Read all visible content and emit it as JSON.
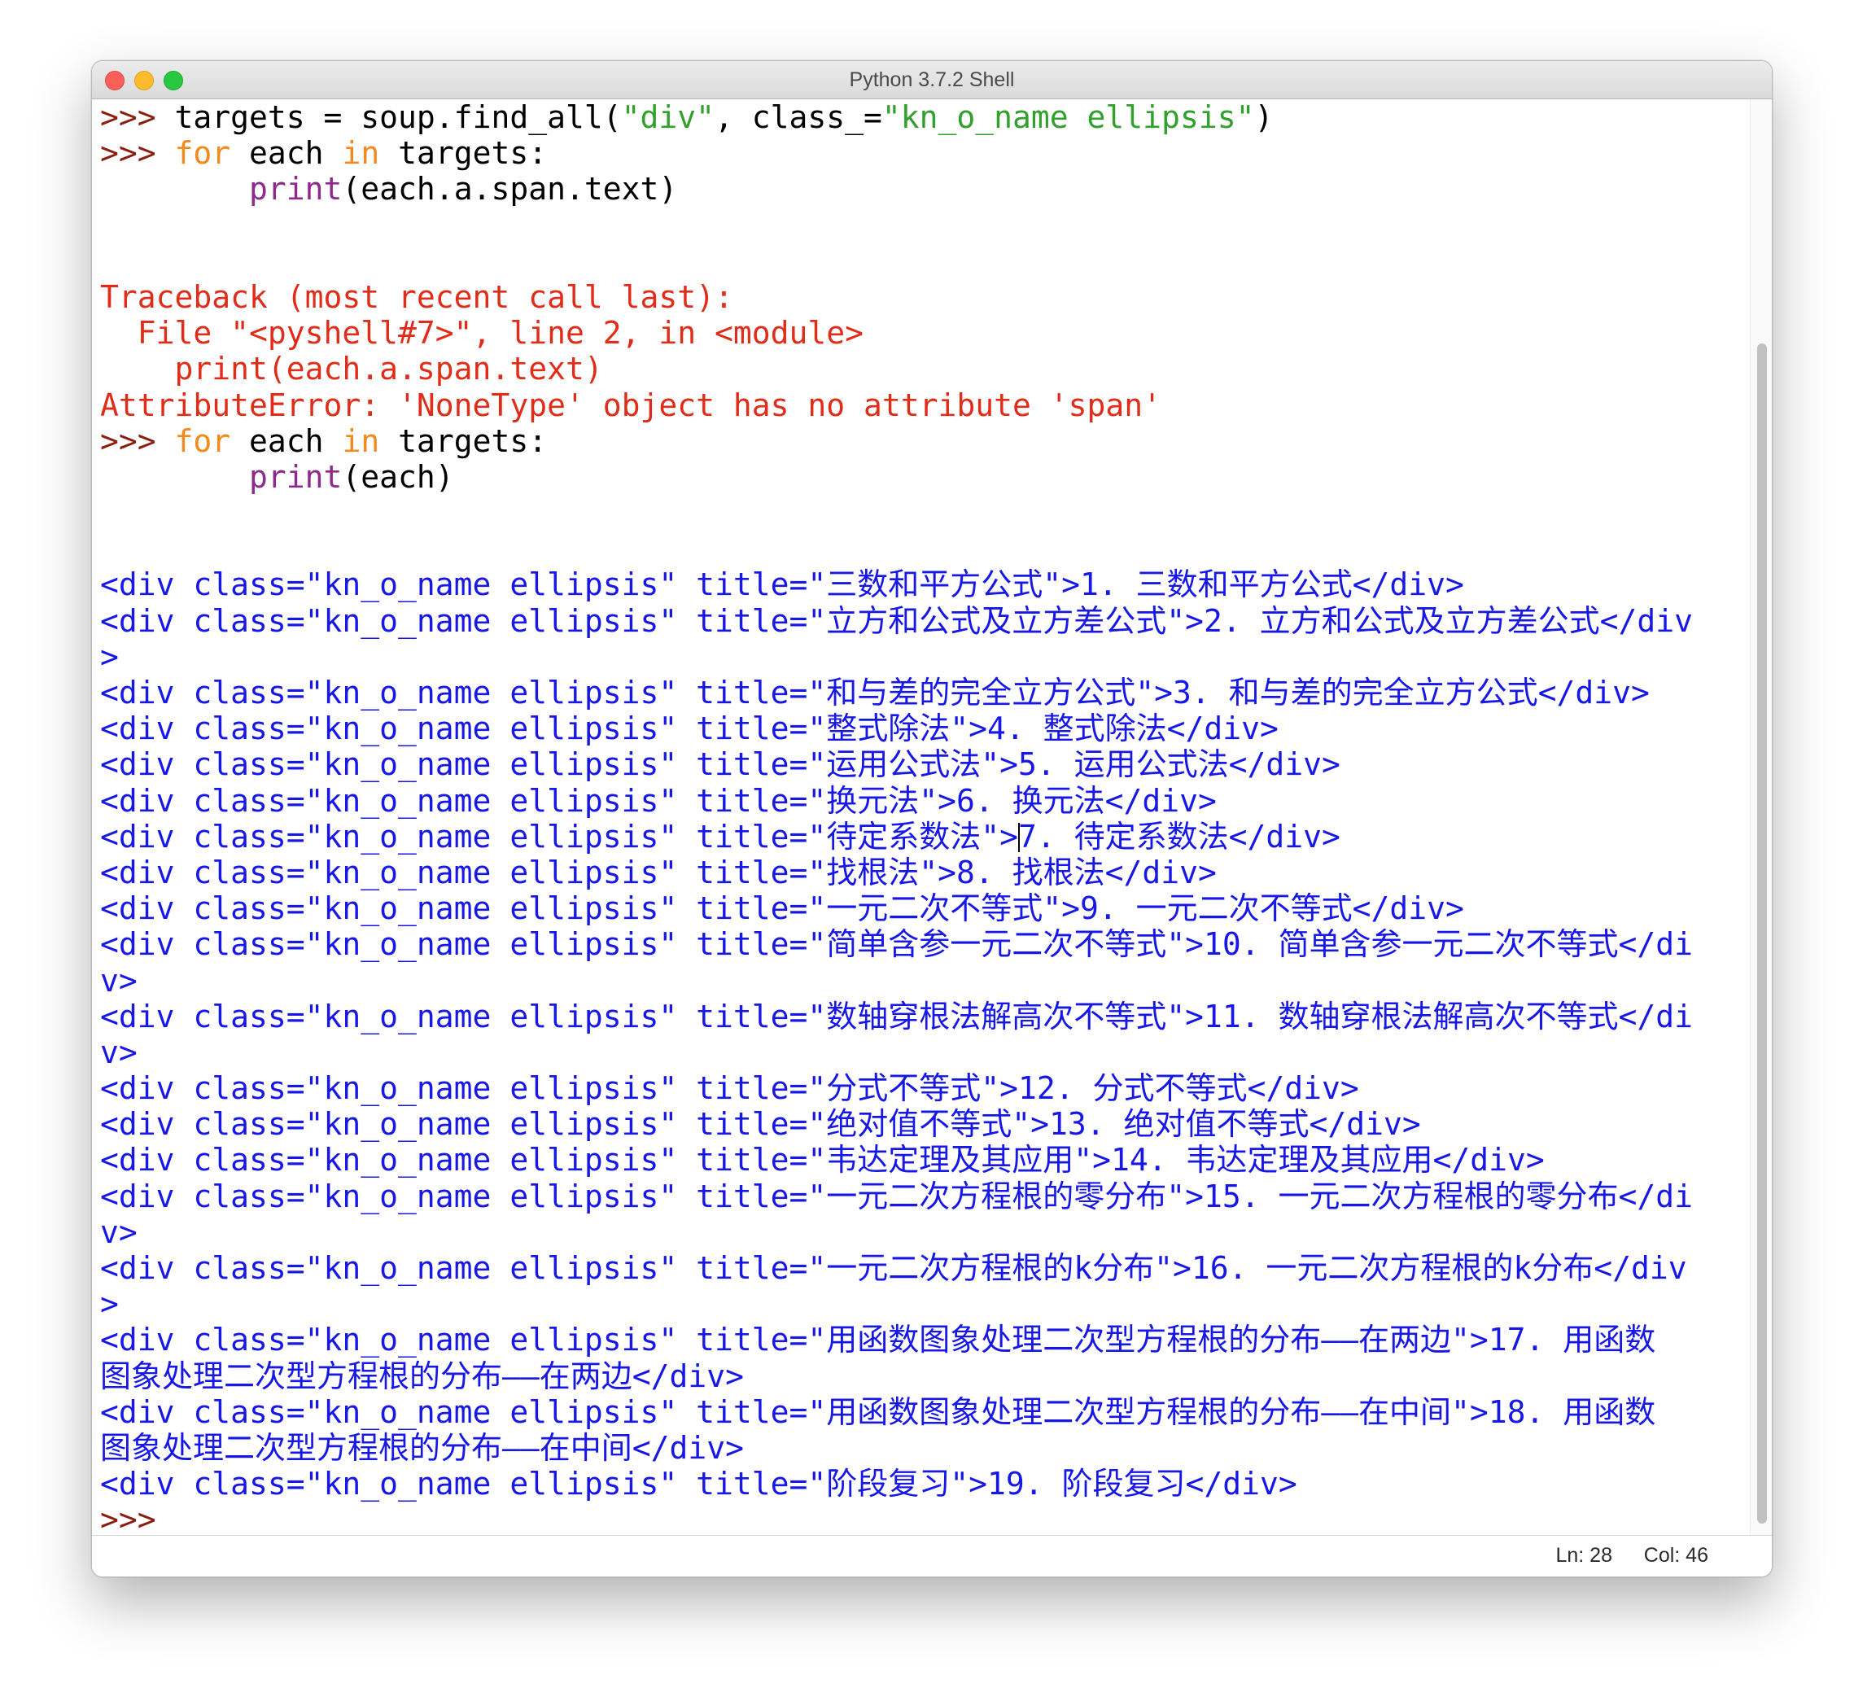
{
  "window": {
    "title": "Python 3.7.2 Shell"
  },
  "status": {
    "line": "Ln: 28",
    "column": "Col: 46"
  },
  "colors": {
    "prompt": "#8a1f11",
    "keyword": "#f38a1e",
    "string": "#32a02c",
    "builtin": "#8e2a8e",
    "error": "#e02d1a",
    "output": "#1818e6"
  },
  "lines": [
    [
      {
        "t": "prompt",
        "v": ">>> "
      },
      {
        "t": "default",
        "v": "targets = soup.find_all("
      },
      {
        "t": "string",
        "v": "\"div\""
      },
      {
        "t": "default",
        "v": ", class_="
      },
      {
        "t": "string",
        "v": "\"kn_o_name ellipsis\""
      },
      {
        "t": "default",
        "v": ")"
      }
    ],
    [
      {
        "t": "prompt",
        "v": ">>> "
      },
      {
        "t": "keyword",
        "v": "for"
      },
      {
        "t": "default",
        "v": " each "
      },
      {
        "t": "keyword",
        "v": "in"
      },
      {
        "t": "default",
        "v": " targets:"
      }
    ],
    [
      {
        "t": "default",
        "v": "        "
      },
      {
        "t": "builtin",
        "v": "print"
      },
      {
        "t": "default",
        "v": "(each.a.span.text)"
      }
    ],
    [],
    [],
    [
      {
        "t": "error",
        "v": "Traceback (most recent call last):"
      }
    ],
    [
      {
        "t": "error",
        "v": "  File \"<pyshell#7>\", line 2, in <module>"
      }
    ],
    [
      {
        "t": "error",
        "v": "    print(each.a.span.text)"
      }
    ],
    [
      {
        "t": "error",
        "v": "AttributeError: 'NoneType' object has no attribute 'span'"
      }
    ],
    [
      {
        "t": "prompt",
        "v": ">>> "
      },
      {
        "t": "keyword",
        "v": "for"
      },
      {
        "t": "default",
        "v": " each "
      },
      {
        "t": "keyword",
        "v": "in"
      },
      {
        "t": "default",
        "v": " targets:"
      }
    ],
    [
      {
        "t": "default",
        "v": "        "
      },
      {
        "t": "builtin",
        "v": "print"
      },
      {
        "t": "default",
        "v": "(each)"
      }
    ],
    [],
    [],
    [
      {
        "t": "output",
        "v": "<div class=\"kn_o_name ellipsis\" title=\"三数和平方公式\">1. 三数和平方公式</div>"
      }
    ],
    [
      {
        "t": "output",
        "v": "<div class=\"kn_o_name ellipsis\" title=\"立方和公式及立方差公式\">2. 立方和公式及立方差公式</div"
      }
    ],
    [
      {
        "t": "output",
        "v": ">"
      }
    ],
    [
      {
        "t": "output",
        "v": "<div class=\"kn_o_name ellipsis\" title=\"和与差的完全立方公式\">3. 和与差的完全立方公式</div>"
      }
    ],
    [
      {
        "t": "output",
        "v": "<div class=\"kn_o_name ellipsis\" title=\"整式除法\">4. 整式除法</div>"
      }
    ],
    [
      {
        "t": "output",
        "v": "<div class=\"kn_o_name ellipsis\" title=\"运用公式法\">5. 运用公式法</div>"
      }
    ],
    [
      {
        "t": "output",
        "v": "<div class=\"kn_o_name ellipsis\" title=\"换元法\">6. 换元法</div>"
      }
    ],
    [
      {
        "t": "output",
        "v": "<div class=\"kn_o_name ellipsis\" title=\"待定系数法\">"
      },
      {
        "t": "caret",
        "v": ""
      },
      {
        "t": "output",
        "v": "7. 待定系数法</div>"
      }
    ],
    [
      {
        "t": "output",
        "v": "<div class=\"kn_o_name ellipsis\" title=\"找根法\">8. 找根法</div>"
      }
    ],
    [
      {
        "t": "output",
        "v": "<div class=\"kn_o_name ellipsis\" title=\"一元二次不等式\">9. 一元二次不等式</div>"
      }
    ],
    [
      {
        "t": "output",
        "v": "<div class=\"kn_o_name ellipsis\" title=\"简单含参一元二次不等式\">10. 简单含参一元二次不等式</di"
      }
    ],
    [
      {
        "t": "output",
        "v": "v>"
      }
    ],
    [
      {
        "t": "output",
        "v": "<div class=\"kn_o_name ellipsis\" title=\"数轴穿根法解高次不等式\">11. 数轴穿根法解高次不等式</di"
      }
    ],
    [
      {
        "t": "output",
        "v": "v>"
      }
    ],
    [
      {
        "t": "output",
        "v": "<div class=\"kn_o_name ellipsis\" title=\"分式不等式\">12. 分式不等式</div>"
      }
    ],
    [
      {
        "t": "output",
        "v": "<div class=\"kn_o_name ellipsis\" title=\"绝对值不等式\">13. 绝对值不等式</div>"
      }
    ],
    [
      {
        "t": "output",
        "v": "<div class=\"kn_o_name ellipsis\" title=\"韦达定理及其应用\">14. 韦达定理及其应用</div>"
      }
    ],
    [
      {
        "t": "output",
        "v": "<div class=\"kn_o_name ellipsis\" title=\"一元二次方程根的零分布\">15. 一元二次方程根的零分布</di"
      }
    ],
    [
      {
        "t": "output",
        "v": "v>"
      }
    ],
    [
      {
        "t": "output",
        "v": "<div class=\"kn_o_name ellipsis\" title=\"一元二次方程根的k分布\">16. 一元二次方程根的k分布</div"
      }
    ],
    [
      {
        "t": "output",
        "v": ">"
      }
    ],
    [
      {
        "t": "output",
        "v": "<div class=\"kn_o_name ellipsis\" title=\"用函数图象处理二次型方程根的分布——在两边\">17. 用函数"
      }
    ],
    [
      {
        "t": "output",
        "v": "图象处理二次型方程根的分布——在两边</div>"
      }
    ],
    [
      {
        "t": "output",
        "v": "<div class=\"kn_o_name ellipsis\" title=\"用函数图象处理二次型方程根的分布——在中间\">18. 用函数"
      }
    ],
    [
      {
        "t": "output",
        "v": "图象处理二次型方程根的分布——在中间</div>"
      }
    ],
    [
      {
        "t": "output",
        "v": "<div class=\"kn_o_name ellipsis\" title=\"阶段复习\">19. 阶段复习</div>"
      }
    ],
    [
      {
        "t": "prompt",
        "v": ">>> "
      }
    ]
  ]
}
